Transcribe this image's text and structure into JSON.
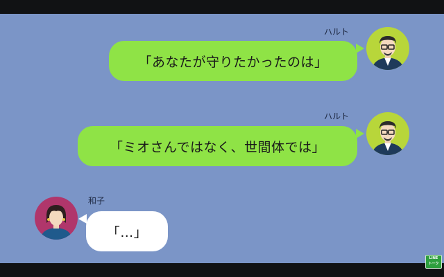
{
  "messages": [
    {
      "sender": "ハルト",
      "text": "「あなたが守りたかったのは」",
      "side": "right"
    },
    {
      "sender": "ハルト",
      "text": "「ミオさんではなく、世間体では」",
      "side": "right"
    },
    {
      "sender": "和子",
      "text": "「…」",
      "side": "left"
    }
  ],
  "avatars": {
    "haruto": "man-with-glasses-avatar",
    "kazuko": "woman-avatar"
  },
  "logo": {
    "line1": "LINE",
    "line2": "トーク"
  },
  "colors": {
    "chat_background": "#7b95c7",
    "own_bubble": "#8fe346",
    "other_bubble": "#ffffff",
    "letterbox": "#111214"
  }
}
